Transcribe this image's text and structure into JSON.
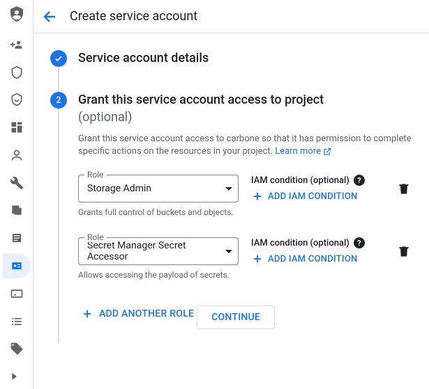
{
  "topbar": {
    "title": "Create service account"
  },
  "step1": {
    "title": "Service account details"
  },
  "step2": {
    "number": "2",
    "title": "Grant this service account access to project",
    "subtitle": "(optional)",
    "description": "Grant this service account access to carbone so that it has permission to complete specific actions on the resources in your project. ",
    "learn_more": "Learn more"
  },
  "roles": [
    {
      "field_label": "Role",
      "value": "Storage Admin",
      "helper": "Grants full control of buckets and objects.",
      "iam_label": "IAM condition (optional)",
      "add_condition": "ADD IAM CONDITION"
    },
    {
      "field_label": "Role",
      "value": "Secret Manager Secret Accessor",
      "helper": "Allows accessing the payload of secrets.",
      "iam_label": "IAM condition (optional)",
      "add_condition": "ADD IAM CONDITION"
    }
  ],
  "add_role": "ADD ANOTHER ROLE",
  "continue": "CONTINUE"
}
